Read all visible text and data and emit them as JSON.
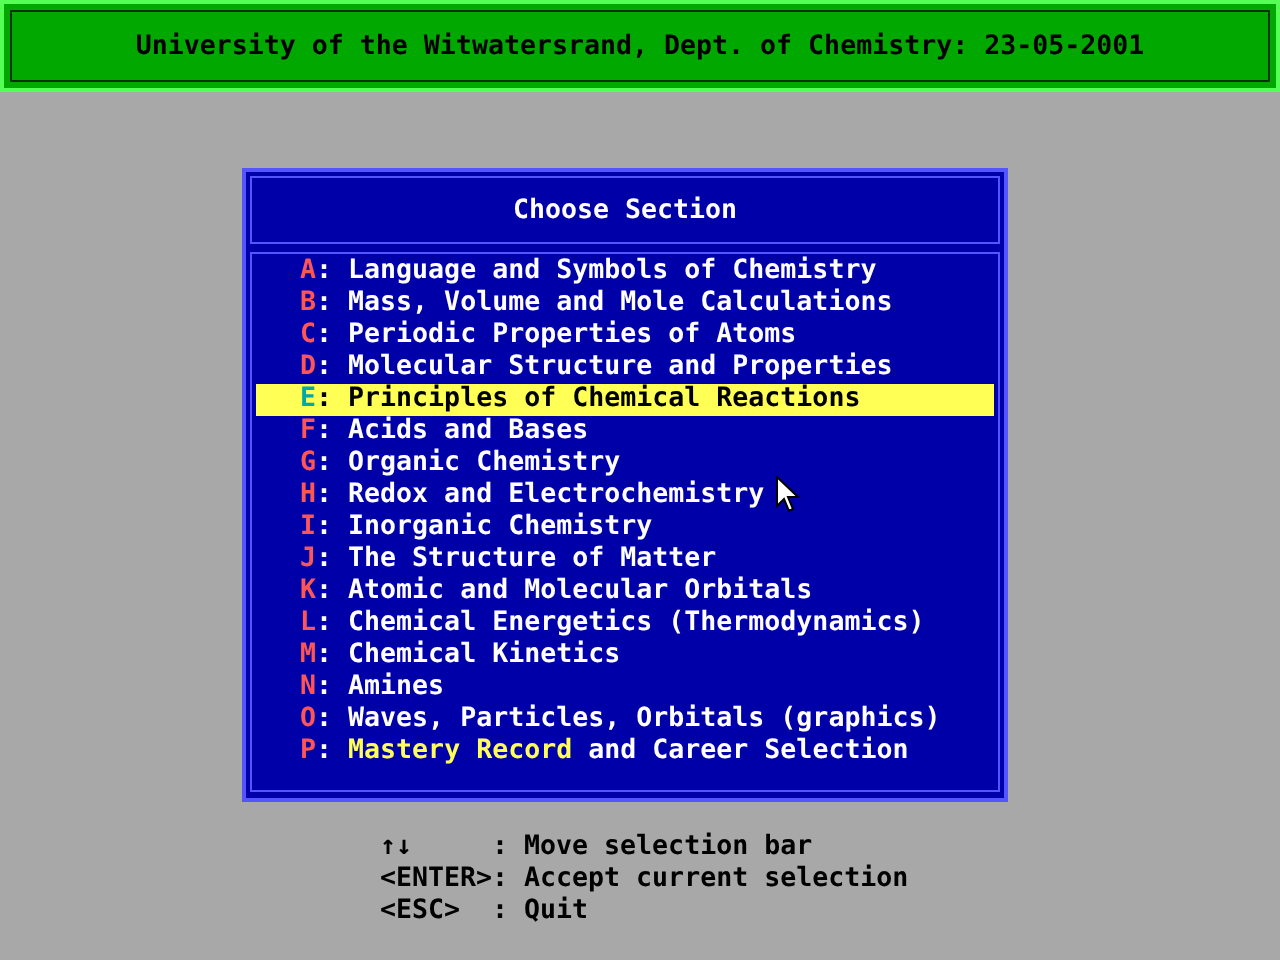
{
  "title_bar": {
    "title": "University of the Witwatersrand, Dept. of Chemistry: 23-05-2001"
  },
  "dialog": {
    "title": "Choose Section",
    "items": [
      {
        "key": "A",
        "label": [
          {
            "text": ": Language and Symbols of Chemistry",
            "highlighted": false
          }
        ],
        "selected": false
      },
      {
        "key": "B",
        "label": [
          {
            "text": ": Mass, Volume and Mole Calculations",
            "highlighted": false
          }
        ],
        "selected": false
      },
      {
        "key": "C",
        "label": [
          {
            "text": ": Periodic Properties of Atoms",
            "highlighted": false
          }
        ],
        "selected": false
      },
      {
        "key": "D",
        "label": [
          {
            "text": ": Molecular Structure and Properties",
            "highlighted": false
          }
        ],
        "selected": false
      },
      {
        "key": "E",
        "label": [
          {
            "text": ": Principles of Chemical Reactions",
            "highlighted": false
          }
        ],
        "selected": true
      },
      {
        "key": "F",
        "label": [
          {
            "text": ": Acids and Bases",
            "highlighted": false
          }
        ],
        "selected": false
      },
      {
        "key": "G",
        "label": [
          {
            "text": ": Organic Chemistry",
            "highlighted": false
          }
        ],
        "selected": false
      },
      {
        "key": "H",
        "label": [
          {
            "text": ": Redox and Electrochemistry",
            "highlighted": false
          }
        ],
        "selected": false
      },
      {
        "key": "I",
        "label": [
          {
            "text": ": Inorganic Chemistry",
            "highlighted": false
          }
        ],
        "selected": false
      },
      {
        "key": "J",
        "label": [
          {
            "text": ": The Structure of Matter",
            "highlighted": false
          }
        ],
        "selected": false
      },
      {
        "key": "K",
        "label": [
          {
            "text": ": Atomic and Molecular Orbitals",
            "highlighted": false
          }
        ],
        "selected": false
      },
      {
        "key": "L",
        "label": [
          {
            "text": ": Chemical Energetics (Thermodynamics)",
            "highlighted": false
          }
        ],
        "selected": false
      },
      {
        "key": "M",
        "label": [
          {
            "text": ": Chemical Kinetics",
            "highlighted": false
          }
        ],
        "selected": false
      },
      {
        "key": "N",
        "label": [
          {
            "text": ": Amines",
            "highlighted": false
          }
        ],
        "selected": false
      },
      {
        "key": "O",
        "label": [
          {
            "text": ": Waves, Particles, Orbitals (graphics)",
            "highlighted": false
          }
        ],
        "selected": false
      },
      {
        "key": "P",
        "label": [
          {
            "text": ": ",
            "highlighted": false
          },
          {
            "text": "Mastery Record",
            "highlighted": true
          },
          {
            "text": " and Career Selection",
            "highlighted": false
          }
        ],
        "selected": false
      }
    ]
  },
  "key_help": [
    {
      "key": "↑↓",
      "action": ": Move selection bar"
    },
    {
      "key": "<ENTER>",
      "action": ": Accept current selection"
    },
    {
      "key": "<ESC>",
      "action": ": Quit"
    }
  ]
}
